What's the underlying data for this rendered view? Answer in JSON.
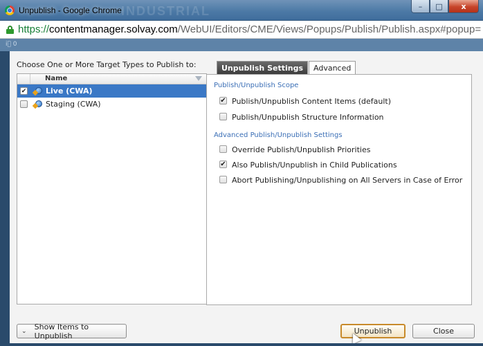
{
  "window": {
    "title": "Unpublish - Google Chrome",
    "watermark": "INDUSTRIAL",
    "controls": {
      "minimize": "–",
      "maximize": "□",
      "close": "x"
    }
  },
  "address_bar": {
    "scheme": "https://",
    "host": "contentmanager.solvay.com",
    "path": "/WebUI/Editors/CME/Views/Popups/Publish/Publish.aspx#popup="
  },
  "toolstrip": {
    "text": "i⃣ 0"
  },
  "targets": {
    "label": "Choose One or More Target Types to Publish to:",
    "column_name": "Name",
    "items": [
      {
        "label": "Live (CWA)",
        "checked": "✔"
      },
      {
        "label": "Staging (CWA)",
        "checked": ""
      }
    ]
  },
  "tabs": [
    {
      "label": "Unpublish Settings"
    },
    {
      "label": "Advanced"
    }
  ],
  "scope": {
    "heading": "Publish/Unpublish Scope",
    "options": [
      {
        "label": "Publish/Unpublish Content Items (default)",
        "mark": "✔"
      },
      {
        "label": "Publish/Unpublish Structure Information",
        "mark": ""
      }
    ]
  },
  "advanced": {
    "heading": "Advanced Publish/Unpublish Settings",
    "options": [
      {
        "label": "Override Publish/Unpublish Priorities",
        "mark": ""
      },
      {
        "label": "Also Publish/Unpublish in Child Publications",
        "mark": "✔"
      },
      {
        "label": "Abort Publishing/Unpublishing on All Servers in Case of Error",
        "mark": ""
      }
    ]
  },
  "buttons": {
    "show_items": "Show Items to Unpublish",
    "show_items_chevron": "⌄",
    "unpublish": "Unpublish",
    "close": "Close"
  },
  "colors": {
    "selected_row": "#3a78c6",
    "section_heading": "#3b6fb6",
    "titlebar": "#4d7aa6"
  }
}
